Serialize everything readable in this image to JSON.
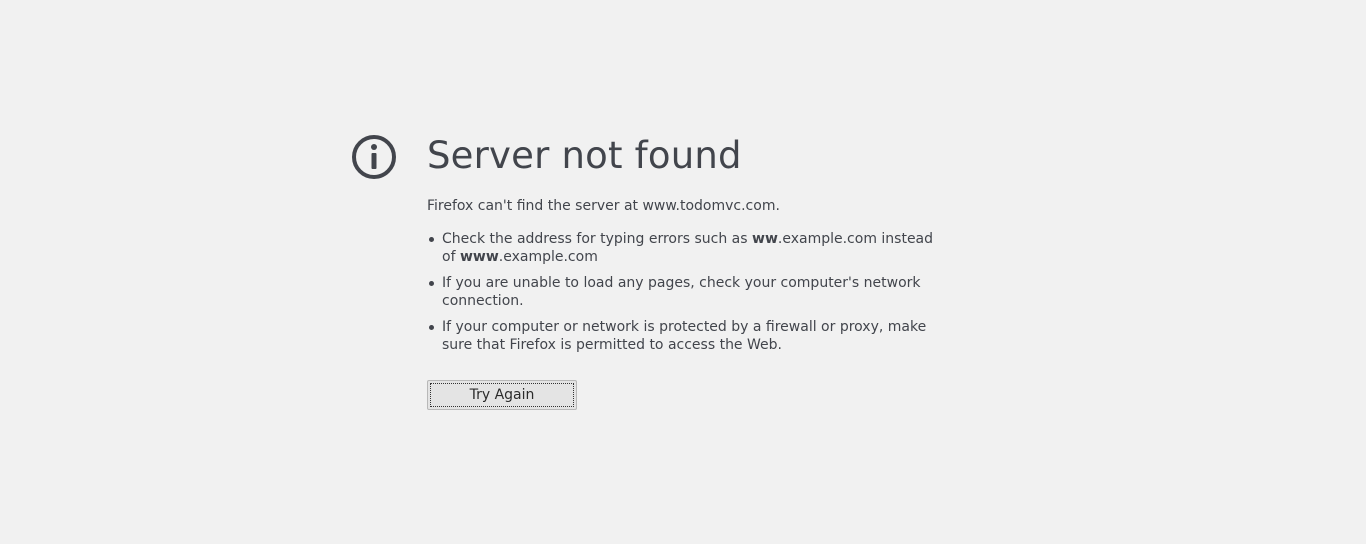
{
  "page": {
    "title": "Server not found",
    "intro": "Firefox can't find the server at www.todomvc.com.",
    "tips": [
      {
        "parts": [
          "Check the address for typing errors such as ",
          "ww",
          ".example.com instead of ",
          "www",
          ".example.com"
        ]
      },
      {
        "text": "If you are unable to load any pages, check your computer's network connection."
      },
      {
        "text": "If your computer or network is protected by a firewall or proxy, make sure that Firefox is permitted to access the Web."
      }
    ],
    "button_label": "Try Again",
    "icon": "info-icon"
  },
  "colors": {
    "background": "#f1f1f1",
    "text": "#42454c",
    "button_bg": "#e4e4e4"
  }
}
